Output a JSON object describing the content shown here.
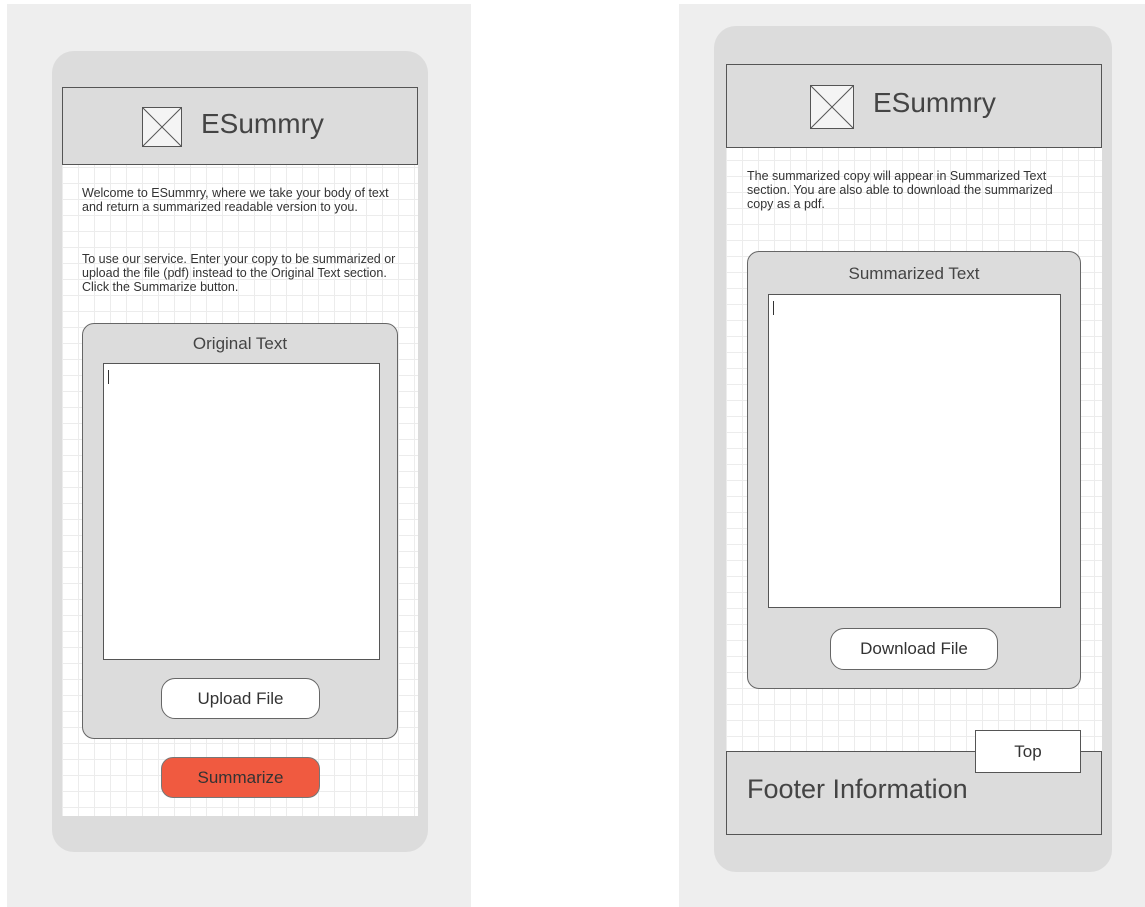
{
  "app": {
    "title": "ESummry"
  },
  "screen1": {
    "intro_paragraph": "Welcome to ESummry, where we take your body of text and return a summarized readable version to you.",
    "instructions_paragraph": "To use our service. Enter your copy to be summarized or upload the file (pdf) instead to the Original Text section. Click the Summarize button.",
    "original_text": {
      "label": "Original Text",
      "value": ""
    },
    "upload_button_label": "Upload File",
    "summarize_button_label": "Summarize"
  },
  "screen2": {
    "info_paragraph": "The summarized copy will appear in Summarized Text section. You are also able to download the summarized copy as a pdf.",
    "summarized_text": {
      "label": "Summarized Text",
      "value": ""
    },
    "download_button_label": "Download File",
    "top_button_label": "Top",
    "footer_text": "Footer Information"
  },
  "colors": {
    "accent": "#f05a40",
    "phone_frame": "#dcdcdc",
    "board": "#eeeeee"
  },
  "icons": {
    "logo": "image-placeholder-icon"
  }
}
